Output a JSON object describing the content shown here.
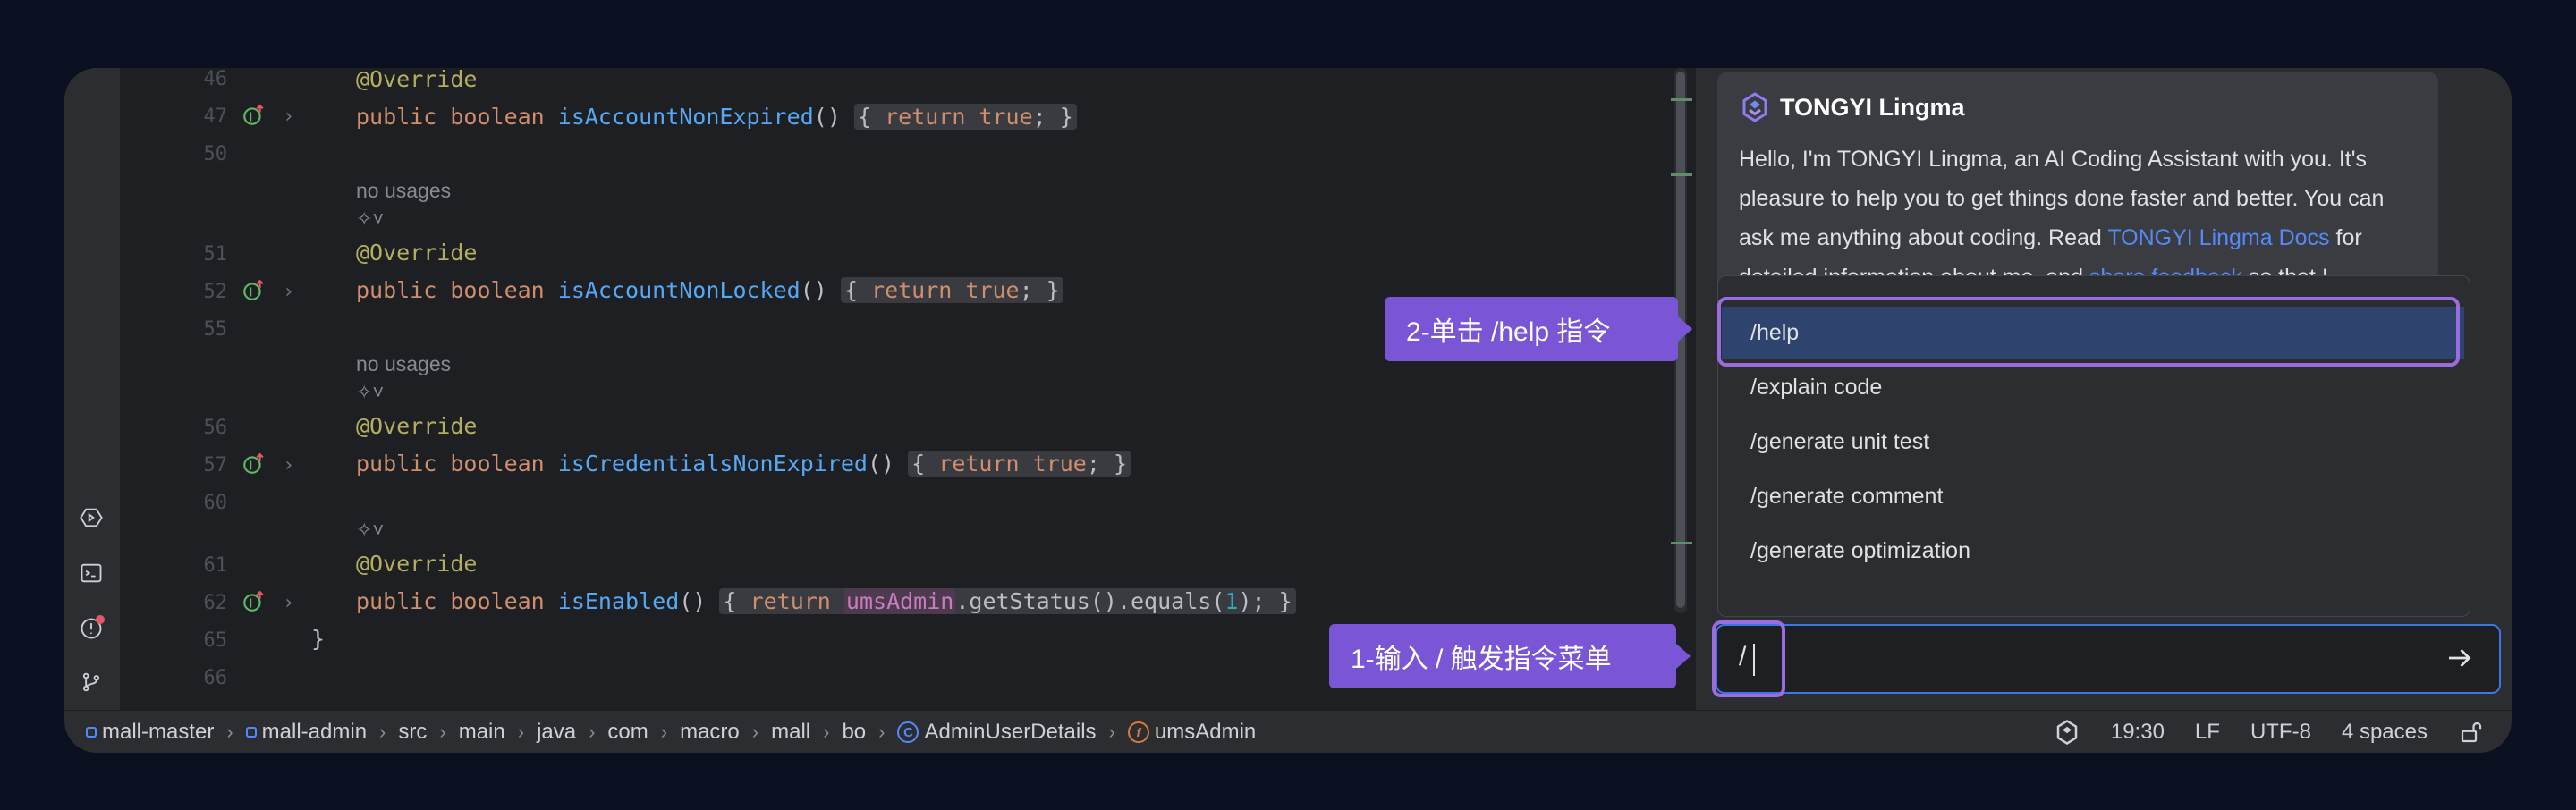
{
  "editor": {
    "lines": [
      {
        "no": "46",
        "top": 0
      },
      {
        "no": "47"
      },
      {
        "no": "50"
      }
    ],
    "hint_no_usages": "no usages",
    "code": {
      "override": "@Override",
      "public_boolean": "public boolean",
      "m1": "isAccountNonExpired",
      "m2": "isAccountNonLocked",
      "m3": "isCredentialsNonExpired",
      "m4": "isEnabled",
      "parens": "()",
      "brace_open": "{",
      "brace_close": "}",
      "ret": "return",
      "true_kw": "true",
      "semi": ";",
      "field": "umsAdmin",
      "chain": ".getStatus().equals(",
      "one": "1",
      "close_call": ");",
      "class_close": "}"
    },
    "line_numbers": [
      "46",
      "47",
      "50",
      "51",
      "52",
      "55",
      "56",
      "57",
      "60",
      "61",
      "62",
      "65",
      "66"
    ]
  },
  "assistant": {
    "brand": "TONGYI Lingma",
    "welcome_part1": "Hello, I'm TONGYI Lingma, an AI Coding Assistant with you. It's pleasure to help you to get things done faster and better. You can ask me anything about coding. Read ",
    "docs_link": "TONGYI Lingma Docs",
    "welcome_part2": " for detailed information about me, and ",
    "feedback_link": "share feedback",
    "welcome_part3": " so that I",
    "commands": [
      "/help",
      "/explain code",
      "/generate unit test",
      "/generate comment",
      "/generate optimization"
    ],
    "selected_command": "/help",
    "input_value": "/"
  },
  "callouts": {
    "step2": "2-单击 /help 指令",
    "step1": "1-输入 / 触发指令菜单"
  },
  "statusbar": {
    "breadcrumbs": [
      "mall-master",
      "mall-admin",
      "src",
      "main",
      "java",
      "com",
      "macro",
      "mall",
      "bo",
      "AdminUserDetails",
      "umsAdmin"
    ],
    "class_icon_letter": "C",
    "field_icon_letter": "f",
    "cursor_pos": "19:30",
    "line_sep": "LF",
    "encoding": "UTF-8",
    "indent": "4 spaces"
  },
  "colors": {
    "accent_purple": "#7a56d6",
    "selection_blue": "#2e436e",
    "link_blue": "#548af7"
  }
}
